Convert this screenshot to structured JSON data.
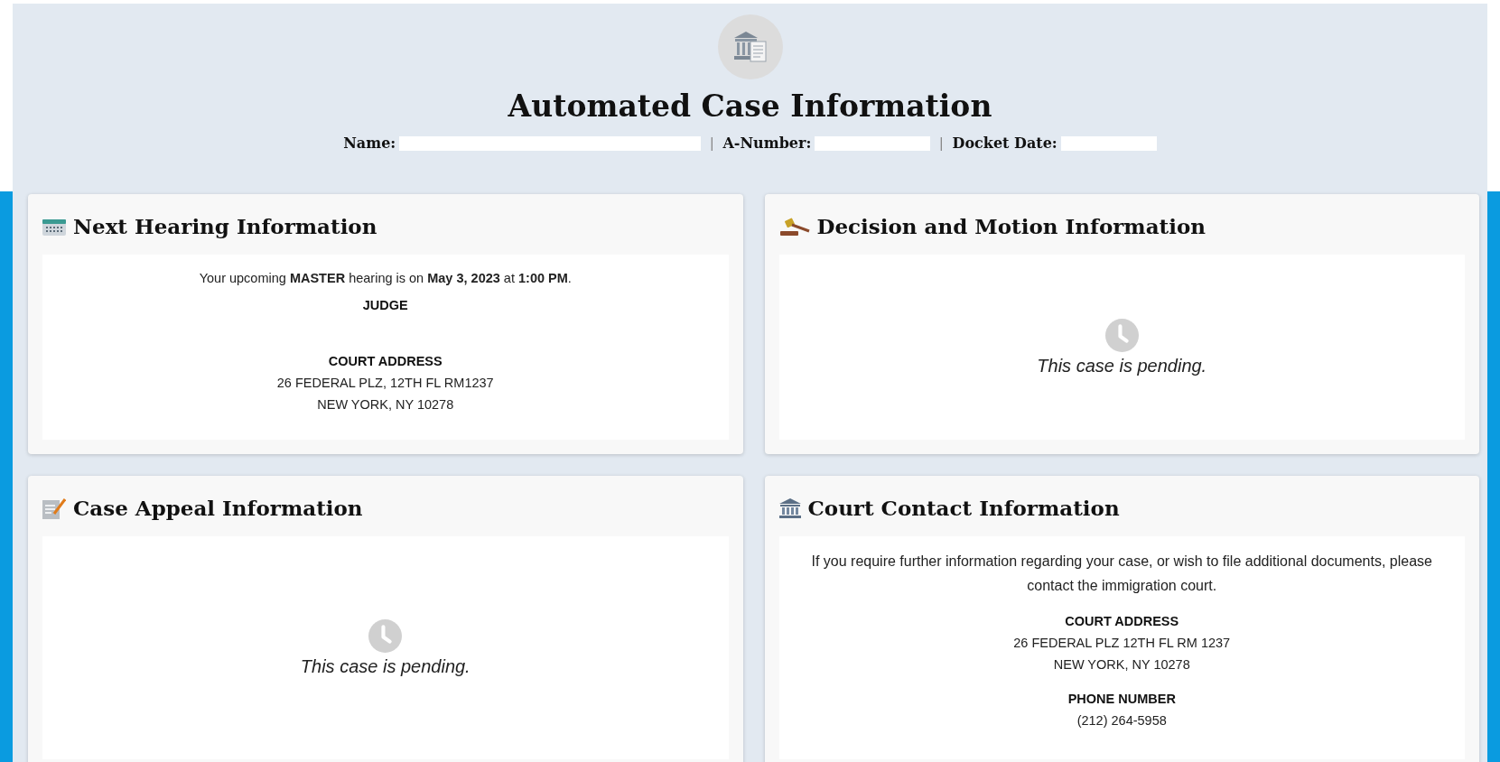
{
  "header": {
    "title": "Automated Case Information",
    "fields": [
      {
        "label": "Name:"
      },
      {
        "separator": "|",
        "label": "A-Number:"
      },
      {
        "separator": "|",
        "label": "Docket Date:"
      }
    ]
  },
  "cards": [
    {
      "kind": "hearing",
      "title": "Next Hearing Information",
      "sentence": "Your upcoming **MASTER** hearing is on **May 3, 2023** at **1:00 PM**.",
      "judge_label": "JUDGE",
      "address_label": "COURT ADDRESS",
      "address_lines": [
        "26 FEDERAL PLZ, 12TH FL RM1237",
        "NEW YORK, NY 10278"
      ]
    },
    {
      "kind": "pending",
      "title": "Decision and Motion Information",
      "message": "This case is pending."
    },
    {
      "kind": "pending",
      "title": "Case Appeal Information",
      "message": "This case is pending."
    },
    {
      "kind": "contact",
      "title": "Court Contact Information",
      "intro": "If you require further information regarding your case, or wish to file additional documents, please contact the immigration court.",
      "sections": [
        {
          "label": "COURT ADDRESS",
          "lines": [
            "26 FEDERAL PLZ 12TH FL RM 1237",
            "NEW YORK, NY 10278"
          ]
        },
        {
          "label": "PHONE NUMBER",
          "lines": [
            "(212) 264-5958"
          ]
        }
      ]
    }
  ]
}
